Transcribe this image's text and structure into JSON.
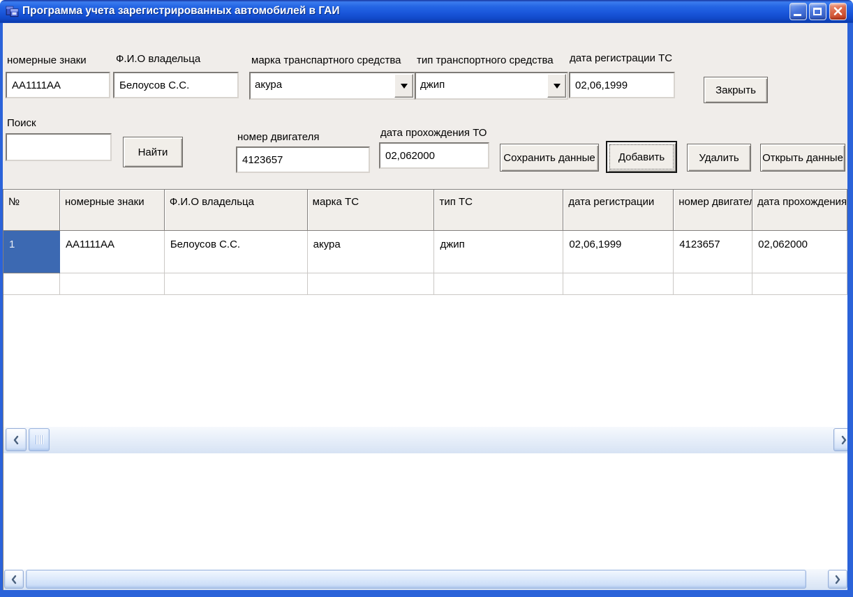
{
  "window": {
    "title": "Программа учета зарегистрированных автомобилей в ГАИ"
  },
  "titlebar_icons": {
    "app_icon": "cascading-forms-icon",
    "minimize": "minimize-bar-icon",
    "maximize": "maximize-window-icon",
    "close": "close-x-icon"
  },
  "form": {
    "plates_label": "номерные знаки",
    "plates_value": "AA1111AA",
    "owner_label": "Ф.И.О владельца",
    "owner_value": "Белоусов С.С.",
    "brand_label": "марка транспартного средства",
    "brand_value": "акура",
    "vehicle_type_label": "тип транспортного средства",
    "vehicle_type_value": "джип",
    "reg_date_label": "дата регистрации ТС",
    "reg_date_value": "02,06,1999",
    "search_label": "Поиск",
    "search_value": "",
    "engine_label": "номер двигателя",
    "engine_value": "4123657",
    "inspection_label": "дата прохождения ТО",
    "inspection_value": "02,062000"
  },
  "buttons": {
    "close_form": "Закрыть",
    "find": "Найти",
    "save": "Сохранить данные",
    "add": "Добавить",
    "delete": "Удалить",
    "open": "Открыть данные"
  },
  "grid": {
    "columns": [
      "№",
      "номерные знаки",
      "Ф.И.О владельца",
      "марка ТС",
      "тип ТС",
      "дата регистрации",
      "номер двигателя",
      "дата прохождения Т"
    ],
    "rows": [
      [
        "1",
        "AA1111AA",
        "Белоусов С.С.",
        "акура",
        "джип",
        "02,06,1999",
        "4123657",
        "02,062000"
      ]
    ]
  },
  "scrollbar_icons": {
    "left": "chevron-left-icon",
    "right": "chevron-right-icon",
    "dropdown": "chevron-down-icon"
  },
  "colors": {
    "titlebar_blue": "#1A57DB",
    "window_border_blue": "#2B63D9",
    "selection_blue": "#3C69B2",
    "close_button_red": "#D6502F",
    "form_background": "#F0EDEA"
  }
}
